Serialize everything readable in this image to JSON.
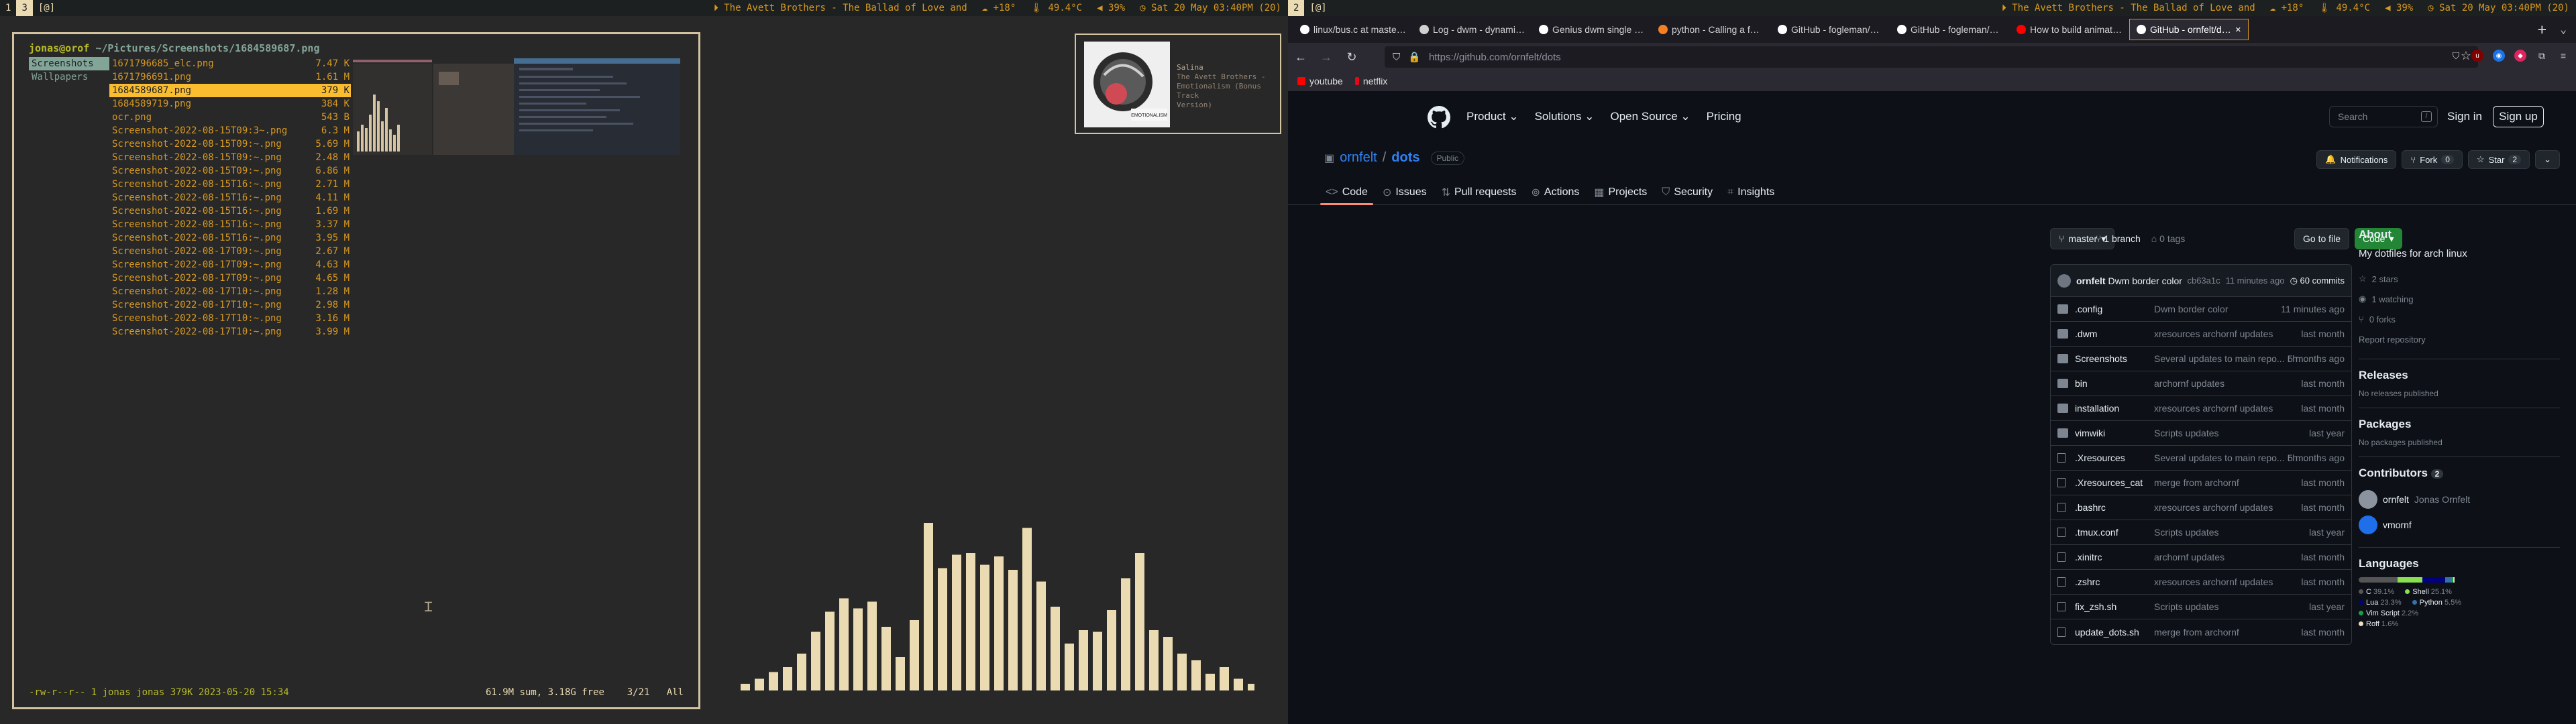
{
  "left_bar": {
    "tags": [
      "1",
      "3"
    ],
    "active_tag": "3",
    "layout": "[@]",
    "song": "The Avett Brothers - The Ballad of Love and",
    "weather": "+18°",
    "temp": "49.4°C",
    "volume": "39%",
    "clock": "Sat 20 May 03:40PM (20)"
  },
  "right_bar": {
    "tag": "2",
    "layout": "[@]",
    "song": "The Avett Brothers - The Ballad of Love and",
    "weather": "+18°",
    "temp": "49.4°C",
    "volume": "39%",
    "clock": "Sat 20 May 03:40PM (20)"
  },
  "lf": {
    "user_host": "jonas@orof",
    "path": "~/Pictures/Screenshots/1684589687.png",
    "parent_items": [
      "Screenshots",
      "Wallpapers"
    ],
    "files": [
      {
        "name": "1671796685_elc.png",
        "size": "7.47 K"
      },
      {
        "name": "1671796691.png",
        "size": "1.61 M"
      },
      {
        "name": "1684589687.png",
        "size": "379 K",
        "selected": true
      },
      {
        "name": "1684589719.png",
        "size": "384 K"
      },
      {
        "name": "ocr.png",
        "size": "543 B"
      },
      {
        "name": "Screenshot-2022-08-15T09:3~.png",
        "size": "6.3 M"
      },
      {
        "name": "Screenshot-2022-08-15T09:~.png",
        "size": "5.69 M"
      },
      {
        "name": "Screenshot-2022-08-15T09:~.png",
        "size": "2.48 M"
      },
      {
        "name": "Screenshot-2022-08-15T09:~.png",
        "size": "6.86 M"
      },
      {
        "name": "Screenshot-2022-08-15T16:~.png",
        "size": "2.71 M"
      },
      {
        "name": "Screenshot-2022-08-15T16:~.png",
        "size": "4.11 M"
      },
      {
        "name": "Screenshot-2022-08-15T16:~.png",
        "size": "1.69 M"
      },
      {
        "name": "Screenshot-2022-08-15T16:~.png",
        "size": "3.37 M"
      },
      {
        "name": "Screenshot-2022-08-15T16:~.png",
        "size": "3.95 M"
      },
      {
        "name": "Screenshot-2022-08-17T09:~.png",
        "size": "2.67 M"
      },
      {
        "name": "Screenshot-2022-08-17T09:~.png",
        "size": "4.63 M"
      },
      {
        "name": "Screenshot-2022-08-17T09:~.png",
        "size": "4.65 M"
      },
      {
        "name": "Screenshot-2022-08-17T10:~.png",
        "size": "1.28 M"
      },
      {
        "name": "Screenshot-2022-08-17T10:~.png",
        "size": "2.98 M"
      },
      {
        "name": "Screenshot-2022-08-17T10:~.png",
        "size": "3.16 M"
      },
      {
        "name": "Screenshot-2022-08-17T10:~.png",
        "size": "3.99 M"
      }
    ],
    "status_left": "-rw-r--r-- 1 jonas jonas 379K 2023-05-20 15:34",
    "status_right_sum": "61.9M sum, 3.18G free",
    "status_right_pos": "3/21",
    "status_right_all": "All"
  },
  "cava_levels": [
    0.04,
    0.07,
    0.11,
    0.14,
    0.22,
    0.35,
    0.47,
    0.55,
    0.49,
    0.53,
    0.38,
    0.2,
    0.42,
    1.0,
    0.73,
    0.81,
    0.82,
    0.75,
    0.8,
    0.72,
    0.97,
    0.65,
    0.5,
    0.28,
    0.36,
    0.35,
    0.48,
    0.67,
    0.82,
    0.36,
    0.32,
    0.22,
    0.18,
    0.1,
    0.14,
    0.07,
    0.04
  ],
  "music": {
    "artist": "Salina",
    "line2": "The Avett Brothers -",
    "line3": "Emotionalism (Bonus Track",
    "line4": "Version)",
    "album_text": "EMOTIONALISM"
  },
  "browser": {
    "tabs": [
      {
        "title": "linux/bus.c at master · tor",
        "icon": "github-icon",
        "active": false
      },
      {
        "title": "Log - dwm - dynamic window",
        "icon": "suckless-icon",
        "active": false
      },
      {
        "title": "Genius dwm single tagset",
        "icon": "github-icon",
        "active": false
      },
      {
        "title": "python - Calling a function",
        "icon": "stackoverflow-icon",
        "active": false
      },
      {
        "title": "GitHub - fogleman/Craft",
        "icon": "github-icon",
        "active": false
      },
      {
        "title": "GitHub - fogleman/primi",
        "icon": "github-icon",
        "active": false
      },
      {
        "title": "How to build animated &",
        "icon": "youtube-icon",
        "active": false
      },
      {
        "title": "GitHub - ornfelt/dots: My",
        "icon": "github-icon",
        "active": true
      }
    ],
    "new_tab": "+",
    "tab_list": "⌄",
    "url": "https://github.com/ornfelt/dots",
    "bookmarks": [
      {
        "label": "youtube",
        "color": "#ff0000"
      },
      {
        "label": "netflix",
        "color": "#e50914"
      }
    ]
  },
  "github": {
    "nav": [
      "Product",
      "Solutions",
      "Open Source",
      "Pricing"
    ],
    "search_placeholder": "Search",
    "search_kbd": "/",
    "signin": "Sign in",
    "signup": "Sign up",
    "owner": "ornfelt",
    "repo": "dots",
    "visibility": "Public",
    "actions": {
      "notifications": "Notifications",
      "fork": "Fork",
      "fork_count": "0",
      "star": "Star",
      "star_count": "2"
    },
    "repo_tabs": [
      "Code",
      "Issues",
      "Pull requests",
      "Actions",
      "Projects",
      "Security",
      "Insights"
    ],
    "branch": "master",
    "branches": "1 branch",
    "tags": "0 tags",
    "go_to_file": "Go to file",
    "code_btn": "Code",
    "commit": {
      "author": "ornfelt",
      "message": "Dwm border color",
      "hash": "cb63a1c",
      "time": "11 minutes ago",
      "count": "60 commits"
    },
    "files": [
      {
        "name": ".config",
        "msg": "Dwm border color",
        "time": "11 minutes ago",
        "type": "dir"
      },
      {
        "name": ".dwm",
        "msg": "xresources archornf updates",
        "time": "last month",
        "type": "dir"
      },
      {
        "name": "Screenshots",
        "msg": "Several updates to main repo... I have used archornf/dotfiles as rep...",
        "time": "5 months ago",
        "type": "dir"
      },
      {
        "name": "bin",
        "msg": "archornf updates",
        "time": "last month",
        "type": "dir"
      },
      {
        "name": "installation",
        "msg": "xresources archornf updates",
        "time": "last month",
        "type": "dir"
      },
      {
        "name": "vimwiki",
        "msg": "Scripts updates",
        "time": "last year",
        "type": "dir"
      },
      {
        "name": ".Xresources",
        "msg": "Several updates to main repo... I have used archornf/dotfiles as rep...",
        "time": "5 months ago",
        "type": "file"
      },
      {
        "name": ".Xresources_cat",
        "msg": "merge from archornf",
        "time": "last month",
        "type": "file"
      },
      {
        "name": ".bashrc",
        "msg": "xresources archornf updates",
        "time": "last month",
        "type": "file"
      },
      {
        "name": ".tmux.conf",
        "msg": "Scripts updates",
        "time": "last year",
        "type": "file"
      },
      {
        "name": ".xinitrc",
        "msg": "archornf updates",
        "time": "last month",
        "type": "file"
      },
      {
        "name": ".zshrc",
        "msg": "xresources archornf updates",
        "time": "last month",
        "type": "file"
      },
      {
        "name": "fix_zsh.sh",
        "msg": "Scripts updates",
        "time": "last year",
        "type": "file"
      },
      {
        "name": "update_dots.sh",
        "msg": "merge from archornf",
        "time": "last month",
        "type": "file"
      }
    ],
    "about": {
      "heading": "About",
      "description": "My dotfiles for arch linux",
      "stars": "2 stars",
      "watching": "1 watching",
      "forks": "0 forks",
      "report": "Report repository"
    },
    "releases": {
      "heading": "Releases",
      "text": "No releases published"
    },
    "packages": {
      "heading": "Packages",
      "text": "No packages published"
    },
    "contributors": {
      "heading": "Contributors",
      "count": "2",
      "list": [
        {
          "login": "ornfelt",
          "name": "Jonas Ornfelt"
        },
        {
          "login": "vmornf",
          "name": ""
        }
      ]
    },
    "languages": {
      "heading": "Languages",
      "list": [
        {
          "name": "C",
          "pct": "39.1%",
          "color": "#555555",
          "share": 39.1
        },
        {
          "name": "Shell",
          "pct": "25.1%",
          "color": "#89e051",
          "share": 25.1
        },
        {
          "name": "Lua",
          "pct": "23.3%",
          "color": "#000080",
          "share": 23.3
        },
        {
          "name": "Python",
          "pct": "5.5%",
          "color": "#3572A5",
          "share": 5.5
        },
        {
          "name": "Vim Script",
          "pct": "2.2%",
          "color": "#199f4b",
          "share": 2.2
        },
        {
          "name": "Roff",
          "pct": "1.6%",
          "color": "#ecdebe",
          "share": 1.6
        }
      ]
    }
  }
}
